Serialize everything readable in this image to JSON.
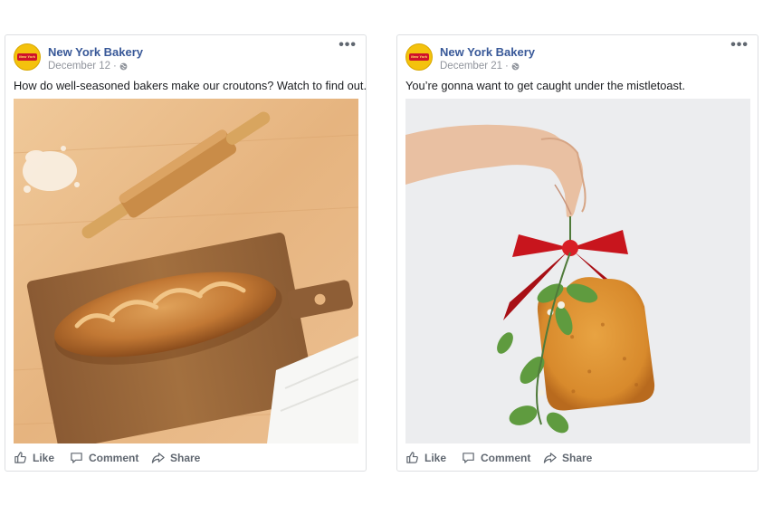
{
  "posts": [
    {
      "page_name": "New York Bakery",
      "date": "December 12",
      "privacy_icon": "globe-icon",
      "caption": "How do well-seasoned bakers make our croutons? Watch to find out.",
      "image_description_icon": "bread-on-cutting-board-image",
      "actions": {
        "like": "Like",
        "comment": "Comment",
        "share": "Share"
      }
    },
    {
      "page_name": "New York Bakery",
      "date": "December 21",
      "privacy_icon": "globe-icon",
      "caption": "You’re gonna want to get caught under the mistletoast.",
      "image_description_icon": "toast-mistletoe-image",
      "actions": {
        "like": "Like",
        "comment": "Comment",
        "share": "Share"
      }
    }
  ],
  "logo_text": "New York",
  "more_icon": "•••",
  "colors": {
    "link": "#385898",
    "muted": "#90949c",
    "action": "#606770",
    "border": "#dddfe2"
  }
}
